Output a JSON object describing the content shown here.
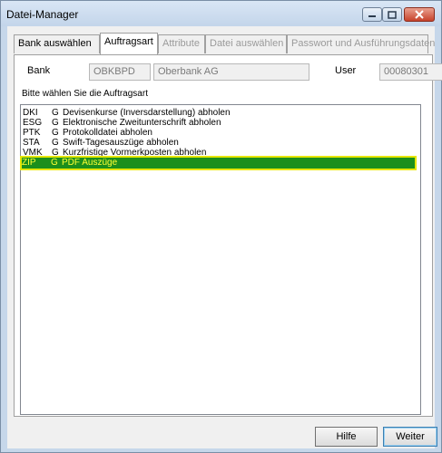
{
  "window": {
    "title": "Datei-Manager"
  },
  "titlebar_icons": {
    "minimize": "minimize-icon",
    "maximize": "maximize-icon",
    "close": "close-icon"
  },
  "tabs": [
    {
      "label": "Bank auswählen",
      "state": "enabled"
    },
    {
      "label": "Auftragsart",
      "state": "active"
    },
    {
      "label": "Attribute",
      "state": "disabled"
    },
    {
      "label": "Datei auswählen",
      "state": "disabled"
    },
    {
      "label": "Passwort und Ausführungsdaten",
      "state": "disabled"
    }
  ],
  "bank": {
    "label": "Bank",
    "code": "OBKBPD",
    "name": "Oberbank AG"
  },
  "user": {
    "label": "User",
    "value": "00080301"
  },
  "instruction": "Bitte wählen Sie die Auftragsart",
  "orders": [
    {
      "code": "DKI",
      "type": "G",
      "desc": "Devisenkurse (Inversdarstellung) abholen"
    },
    {
      "code": "ESG",
      "type": "G",
      "desc": "Elektronische Zweitunterschrift abholen"
    },
    {
      "code": "PTK",
      "type": "G",
      "desc": "Protokolldatei abholen"
    },
    {
      "code": "STA",
      "type": "G",
      "desc": "Swift-Tagesauszüge abholen"
    },
    {
      "code": "VMK",
      "type": "G",
      "desc": "Kurzfristige Vormerkposten abholen"
    },
    {
      "code": "ZIP",
      "type": "G",
      "desc": "PDF Auszüge",
      "selected": true
    }
  ],
  "buttons": {
    "help": "Hilfe",
    "next": "Weiter"
  },
  "colors": {
    "selection_bg": "#1c8f1c",
    "selection_text": "#ffff33",
    "selection_outline": "#e6e600"
  }
}
